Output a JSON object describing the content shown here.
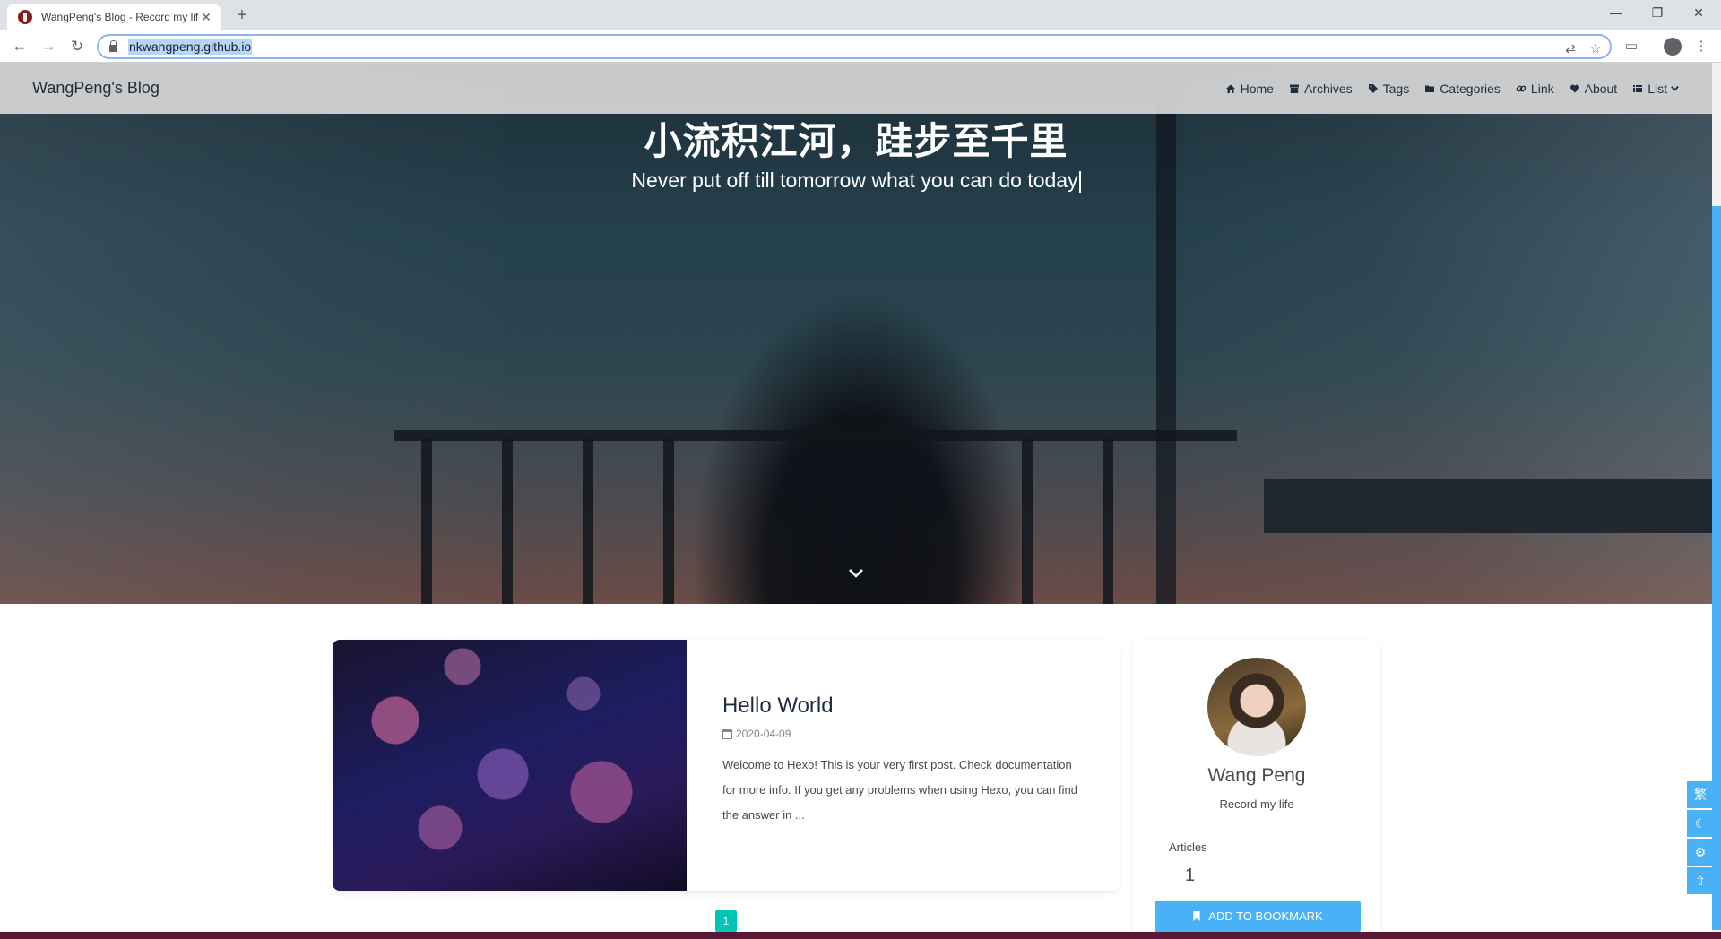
{
  "browser": {
    "tab_title": "WangPeng's Blog - Record my life",
    "url": "nkwangpeng.github.io",
    "new_tab": "+",
    "minimize": "—",
    "restore": "❐",
    "close": "✕"
  },
  "navbar": {
    "brand": "WangPeng's Blog",
    "menu": [
      {
        "label": "Home",
        "icon": "home-icon"
      },
      {
        "label": "Archives",
        "icon": "archive-icon"
      },
      {
        "label": "Tags",
        "icon": "tags-icon"
      },
      {
        "label": "Categories",
        "icon": "folder-icon"
      },
      {
        "label": "Link",
        "icon": "link-icon"
      },
      {
        "label": "About",
        "icon": "heart-icon"
      },
      {
        "label": "List",
        "icon": "list-icon"
      }
    ]
  },
  "hero": {
    "title": "小流积江河，跬步至千里",
    "subtitle": "Never put off till tomorrow what you can do today"
  },
  "post": {
    "title": "Hello World",
    "date": "2020-04-09",
    "excerpt": "Welcome to Hexo! This is your very first post. Check documentation for more info. If you get any problems when using Hexo, you can find the answer in ..."
  },
  "pagination": {
    "current": "1"
  },
  "author": {
    "name": "Wang Peng",
    "description": "Record my life",
    "articles_label": "Articles",
    "articles_count": "1",
    "bookmark_label": "ADD TO BOOKMARK"
  },
  "rightside": {
    "translate": "繁",
    "darkmode": "☾",
    "settings": "⚙",
    "top": "⇧"
  },
  "colors": {
    "accent": "#49b1f5",
    "pagination": "#00c4b6"
  }
}
